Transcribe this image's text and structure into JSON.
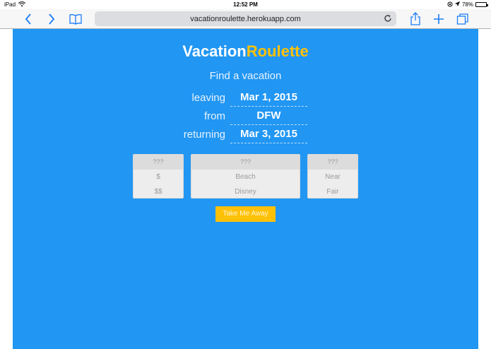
{
  "status_bar": {
    "device": "iPad",
    "time": "12:52 PM",
    "battery": "78%",
    "battery_level": 0.78
  },
  "browser": {
    "url": "vacationroulette.herokuapp.com",
    "icons": {
      "back": "chevron-left-icon",
      "forward": "chevron-right-icon",
      "bookmarks": "book-icon",
      "reload": "reload-icon",
      "share": "share-icon",
      "new_tab": "plus-icon",
      "tabs": "tabs-icon"
    }
  },
  "page": {
    "title_part1": "Vacation",
    "title_part2": "Roulette",
    "tagline": "Find a vacation",
    "trip": [
      {
        "label": "leaving",
        "value": "Mar 1, 2015"
      },
      {
        "label": "from",
        "value": "DFW"
      },
      {
        "label": "returning",
        "value": "Mar 3, 2015"
      }
    ],
    "pickers": [
      {
        "head": "???",
        "items": [
          "$",
          "$$"
        ]
      },
      {
        "head": "???",
        "items": [
          "Beach",
          "Disney"
        ]
      },
      {
        "head": "???",
        "items": [
          "Near",
          "Fair"
        ]
      }
    ],
    "button_label": "Take Me Away"
  },
  "colors": {
    "background": "#2196f3",
    "accent": "#ffc107",
    "ios_blue": "#1b7cf6"
  }
}
